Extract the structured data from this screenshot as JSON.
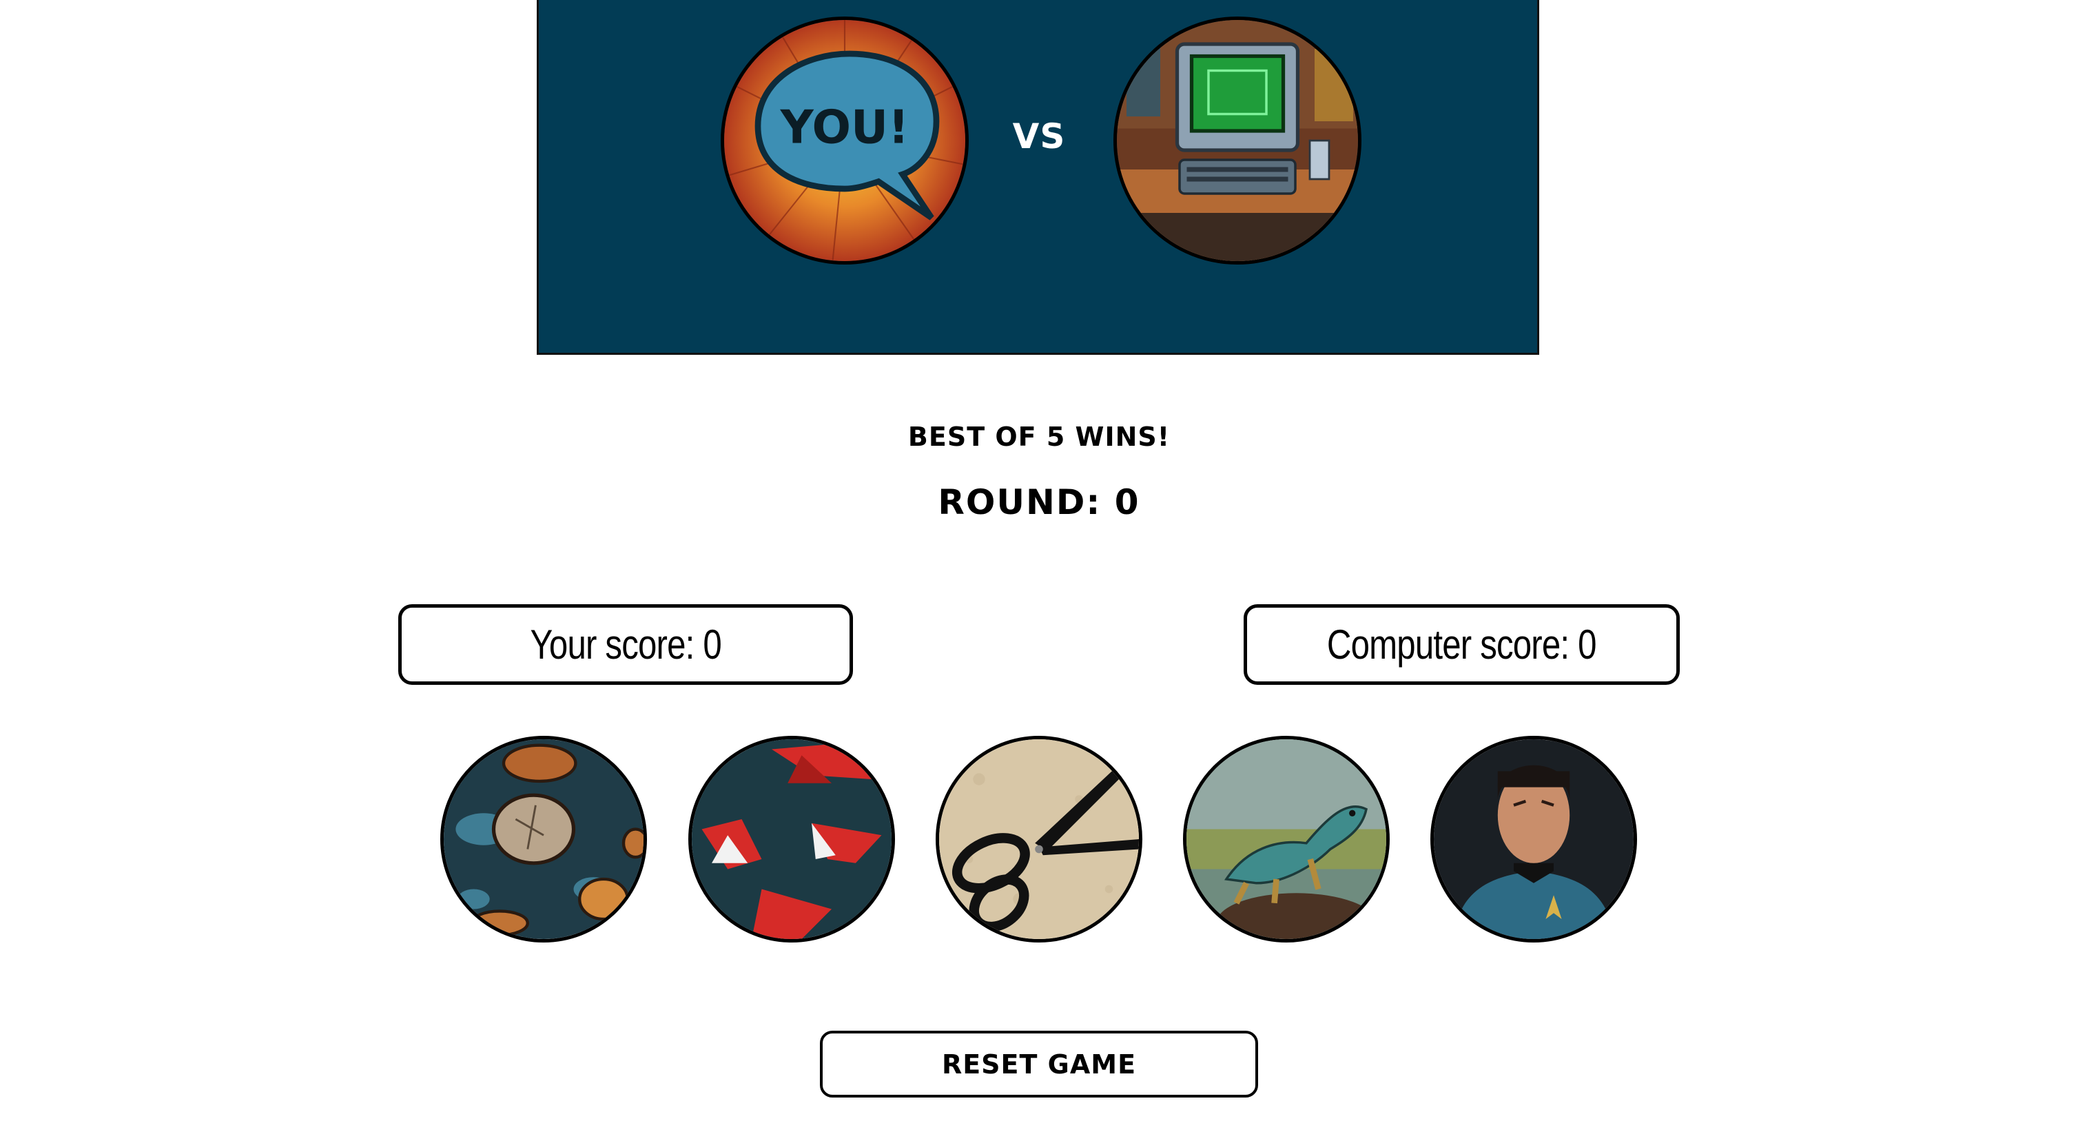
{
  "banner": {
    "vs_text": "VS",
    "player_avatar_lettering": "YOU!",
    "background_color": "#023c55"
  },
  "game": {
    "subtitle": "BEST OF 5 WINS!",
    "round_label": "ROUND: 0"
  },
  "scores": {
    "player_label": "Your score: 0",
    "computer_label": "Computer score: 0"
  },
  "choices": [
    {
      "name": "rock",
      "icon": "rock-icon"
    },
    {
      "name": "paper",
      "icon": "paper-icon"
    },
    {
      "name": "scissors",
      "icon": "scissors-icon"
    },
    {
      "name": "lizard",
      "icon": "lizard-icon"
    },
    {
      "name": "spock",
      "icon": "spock-icon"
    }
  ],
  "controls": {
    "reset_label": "RESET GAME"
  }
}
